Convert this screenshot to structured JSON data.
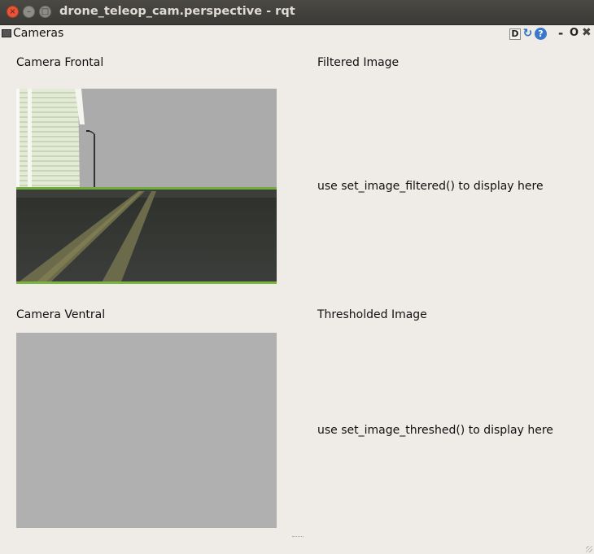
{
  "window": {
    "title": "drone_teleop_cam.perspective - rqt",
    "close_glyph": "×",
    "minimize_glyph": "–",
    "maximize_glyph": "□"
  },
  "dock": {
    "title": "Cameras",
    "icon": "dock-window-icon",
    "buttons": {
      "d_label": "D",
      "refresh_glyph": "↻",
      "help_glyph": "?",
      "minimize_glyph": "-",
      "float_glyph": "O",
      "close_glyph": "✖"
    }
  },
  "panels": {
    "frontal_label": "Camera Frontal",
    "filtered_label": "Filtered Image",
    "filtered_msg": "use set_image_filtered() to display here",
    "ventral_label": "Camera Ventral",
    "thresholded_label": "Thresholded Image",
    "thresholded_msg": "use set_image_threshed() to display here"
  },
  "colors": {
    "background": "#efebe7",
    "titlebar": "#3b3a36",
    "close_button": "#e8553a",
    "ventral_image": "#b0b0b0"
  }
}
